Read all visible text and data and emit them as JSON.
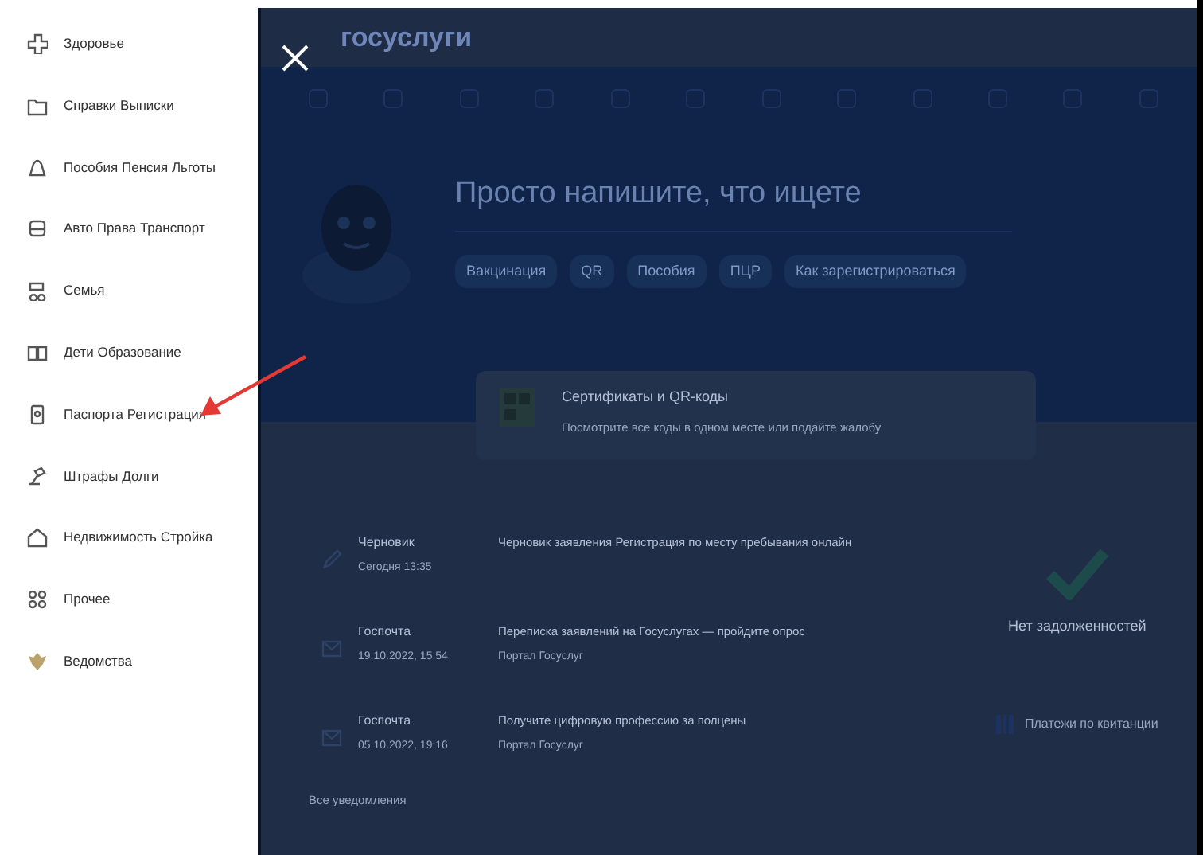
{
  "menu": {
    "items": [
      {
        "label": "Здоровье"
      },
      {
        "label": "Справки Выписки"
      },
      {
        "label": "Пособия Пенсия Льготы"
      },
      {
        "label": "Авто Права Транспорт"
      },
      {
        "label": "Семья"
      },
      {
        "label": "Дети Образование"
      },
      {
        "label": "Паспорта Регистрация"
      },
      {
        "label": "Штрафы Долги"
      },
      {
        "label": "Недвижимость Стройка"
      },
      {
        "label": "Прочее"
      },
      {
        "label": "Ведомства"
      }
    ]
  },
  "background_page": {
    "logo": "госуслуги",
    "search": {
      "placeholder": "Просто напишите, что ищете"
    },
    "chips": [
      "Вакцинация",
      "QR",
      "Пособия",
      "ПЦР",
      "Как зарегистрироваться"
    ],
    "promo_card": {
      "title": "Сертификаты и QR-коды",
      "text": "Посмотрите все коды в одном месте или подайте жалобу"
    },
    "feed": [
      {
        "source": "Черновик",
        "date": "Сегодня 13:35",
        "title": "Черновик заявления Регистрация по месту пребывания онлайн"
      },
      {
        "source": "Госпочта",
        "date": "19.10.2022, 15:54",
        "title": "Переписка заявлений на Госуслугах — пройдите опрос",
        "subtitle": "Портал Госуслуг"
      },
      {
        "source": "Госпочта",
        "date": "05.10.2022, 19:16",
        "title": "Получите цифровую профессию за полцены",
        "subtitle": "Портал Госуслуг"
      }
    ],
    "debts": "Нет задолженностей",
    "payments": "Платежи по квитанции",
    "all_notifications": "Все уведомления"
  }
}
